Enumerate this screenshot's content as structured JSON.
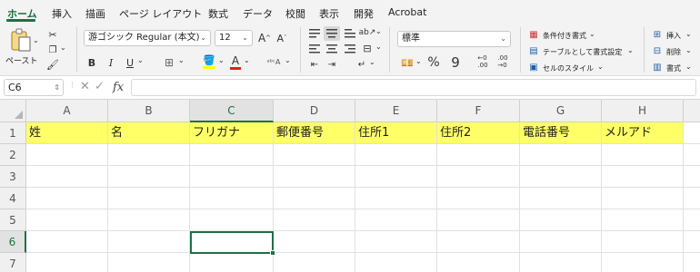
{
  "tabs": [
    "ホーム",
    "挿入",
    "描画",
    "ページ レイアウト",
    "数式",
    "データ",
    "校閲",
    "表示",
    "開発",
    "Acrobat"
  ],
  "clipboard": {
    "paste_label": "ペースト"
  },
  "font": {
    "name": "游ゴシック Regular (本文)",
    "size": "12"
  },
  "number_format": {
    "value": "標準"
  },
  "styles": {
    "conditional": "条件付き書式",
    "table": "テーブルとして書式設定",
    "cell_style": "セルのスタイル"
  },
  "cells_group": {
    "insert": "挿入",
    "delete": "削除",
    "format": "書式"
  },
  "formula_bar": {
    "name_box": "C6",
    "fx": "fx",
    "value": ""
  },
  "columns": [
    "A",
    "B",
    "C",
    "D",
    "E",
    "F",
    "G",
    "H"
  ],
  "selected_column": "C",
  "rows": [
    "1",
    "2",
    "3",
    "4",
    "5",
    "6",
    "7"
  ],
  "selected_row": "6",
  "row1": [
    "姓",
    "名",
    "フリガナ",
    "郵便番号",
    "住所1",
    "住所2",
    "電話番号",
    "メルアド"
  ],
  "highlight_color": "#ffff66",
  "accent_color": "#1e7145"
}
